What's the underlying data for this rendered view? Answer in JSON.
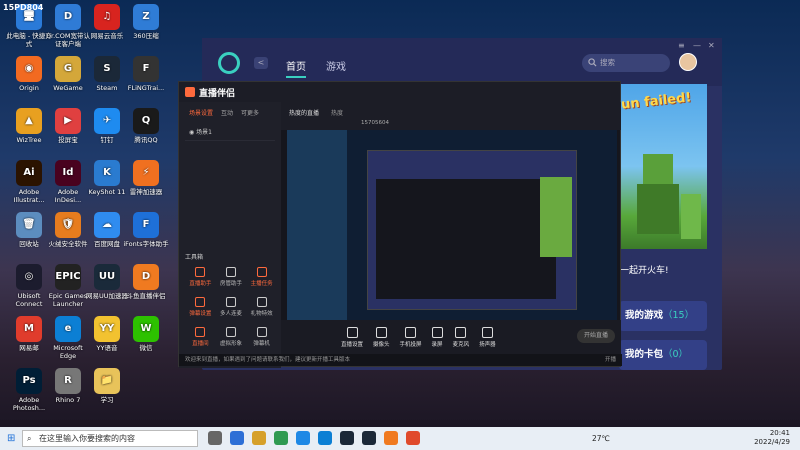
{
  "desktop_icons": [
    {
      "label": "此电脑 - 快捷方式",
      "color": "#2a7ad8",
      "glyph": "🖥"
    },
    {
      "label": "Origin",
      "color": "#f26a21",
      "glyph": "◉"
    },
    {
      "label": "WizTree",
      "color": "#e8a020",
      "glyph": "▲"
    },
    {
      "label": "Adobe Illustrat...",
      "color": "#2b1300",
      "glyph": "Ai"
    },
    {
      "label": "回收站",
      "color": "#5c8dbf",
      "glyph": "🗑"
    },
    {
      "label": "Ubisoft Connect",
      "color": "#1c1c2e",
      "glyph": "◎"
    },
    {
      "label": "网易邮",
      "color": "#e03c2c",
      "glyph": "M"
    },
    {
      "label": "Adobe Photosh...",
      "color": "#001e36",
      "glyph": "Ps"
    },
    {
      "label": "Dr.COM宽带认证客户端",
      "color": "#2f7bd6",
      "glyph": "D"
    },
    {
      "label": "WeGame",
      "color": "#d4a73a",
      "glyph": "G"
    },
    {
      "label": "投屏宝",
      "color": "#e04040",
      "glyph": "▶"
    },
    {
      "label": "Adobe InDesi...",
      "color": "#49021f",
      "glyph": "Id"
    },
    {
      "label": "火绒安全软件",
      "color": "#e77c1e",
      "glyph": "🛡"
    },
    {
      "label": "Epic Games Launcher",
      "color": "#222",
      "glyph": "EPIC"
    },
    {
      "label": "Microsoft Edge",
      "color": "#0c7fd4",
      "glyph": "e"
    },
    {
      "label": "Rhino 7",
      "color": "#777",
      "glyph": "R"
    },
    {
      "label": "网易云音乐",
      "color": "#d8241f",
      "glyph": "♫"
    },
    {
      "label": "Steam",
      "color": "#1b2838",
      "glyph": "S"
    },
    {
      "label": "钉钉",
      "color": "#1e8bf0",
      "glyph": "✈"
    },
    {
      "label": "KeyShot 11",
      "color": "#2a7bd0",
      "glyph": "K"
    },
    {
      "label": "百度网盘",
      "color": "#2f8cf0",
      "glyph": "☁"
    },
    {
      "label": "网易UU加速器",
      "color": "#1a2a3a",
      "glyph": "UU"
    },
    {
      "label": "YY语音",
      "color": "#f2c230",
      "glyph": "YY"
    },
    {
      "label": "学习",
      "color": "#e8c35a",
      "glyph": "📁"
    },
    {
      "label": "360压缩",
      "color": "#2f7cd6",
      "glyph": "Z"
    },
    {
      "label": "FLiNGTrai...",
      "color": "#333",
      "glyph": "F"
    },
    {
      "label": "腾讯QQ",
      "color": "#1a1a1a",
      "glyph": "Q"
    },
    {
      "label": "雷神加速器",
      "color": "#f07020",
      "glyph": "⚡"
    },
    {
      "label": "iFonts字体助手",
      "color": "#1e70d8",
      "glyph": "F"
    },
    {
      "label": "斗鱼直播伴侣",
      "color": "#f07a20",
      "glyph": "D"
    },
    {
      "label": "微信",
      "color": "#2dc100",
      "glyph": "W"
    }
  ],
  "desktop_header_text": "15PD804",
  "right_app": {
    "tabs": [
      "首页",
      "游戏"
    ],
    "back_label": "<",
    "search_placeholder": "搜索",
    "window_controls": [
      "≡",
      "—",
      "✕"
    ],
    "banner_title": "un failed!",
    "slogan": "一起开火车!",
    "my_games_label": "我的游戏",
    "my_games_count": "（15）",
    "my_cards_label": "我的卡包",
    "my_cards_count": "（0）"
  },
  "mid_window": {
    "title": "直播伴侣",
    "tabs": [
      "场景设置",
      "互动",
      "可更多"
    ],
    "scene_label": "场景1",
    "tools_title": "工具箱",
    "tools": [
      {
        "label": "直播助手",
        "hot": true
      },
      {
        "label": "房管助手",
        "hot": false
      },
      {
        "label": "主播任务",
        "hot": true
      },
      {
        "label": "弹幕设置",
        "hot": true
      },
      {
        "label": "多人连麦",
        "hot": false
      },
      {
        "label": "礼物特效",
        "hot": false
      },
      {
        "label": "直播间",
        "hot": true
      },
      {
        "label": "虚拟形象",
        "hot": false
      },
      {
        "label": "弹幕机",
        "hot": false
      }
    ],
    "header_right_label": "热度的直播",
    "header_tag": "热度",
    "room_id": "15705604",
    "bottom_buttons": [
      "直播设置",
      "摄像头",
      "手机投屏",
      "录屏",
      "麦克风",
      "扬声器"
    ],
    "live_button": "开始直播",
    "status_text": "欢迎来到直播，如果遇到了问题请联系我们，建议更新开播工具版本",
    "status_right": "开播"
  },
  "taskbar": {
    "search_placeholder": "在这里输入你要搜索的内容",
    "temperature": "27℃",
    "time": "20:41",
    "date": "2022/4/29",
    "app_colors": [
      "#666",
      "#2d6fd6",
      "#d6a02a",
      "#2f9a52",
      "#1e88e5",
      "#0c7fd4",
      "#1b2838",
      "#1b2838",
      "#f07a20",
      "#e04a2c"
    ]
  }
}
